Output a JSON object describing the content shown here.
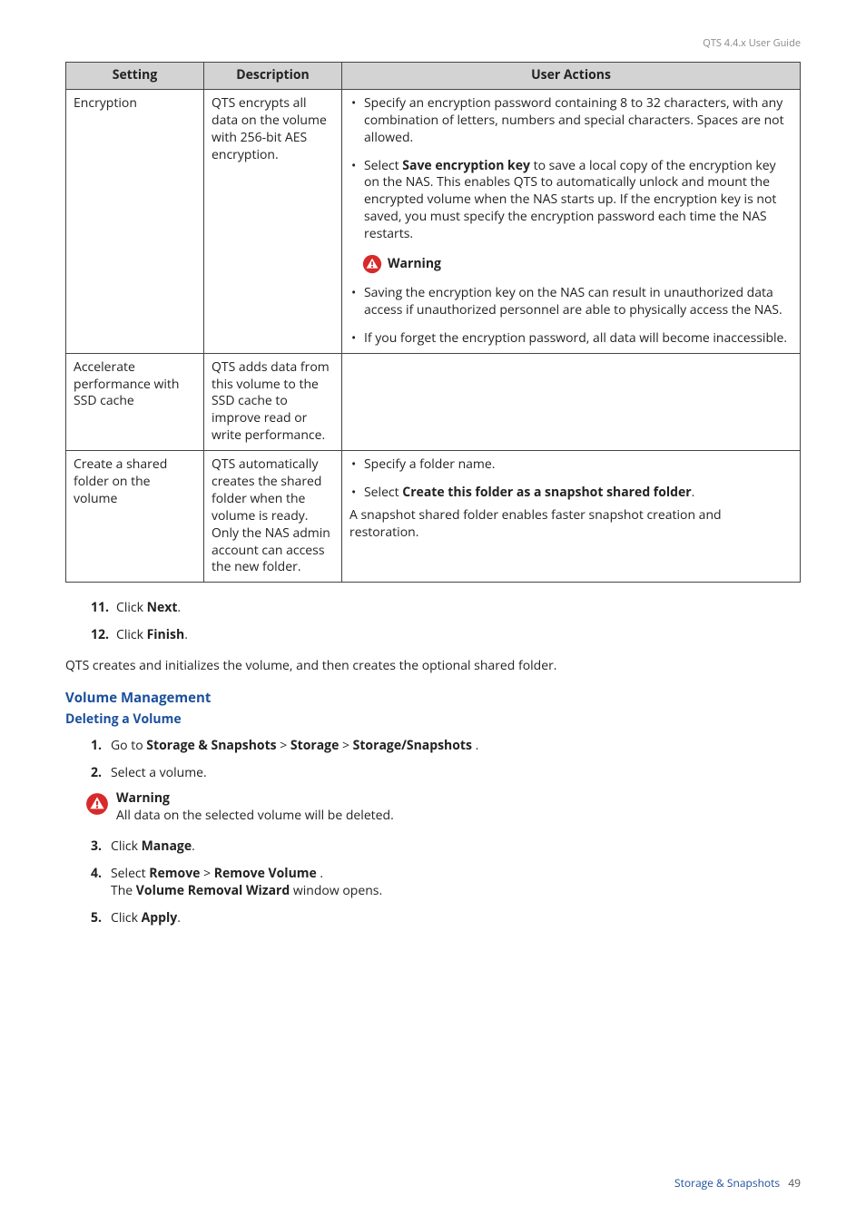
{
  "header": {
    "guide_title": "QTS 4.4.x User Guide"
  },
  "table": {
    "headers": {
      "setting": "Setting",
      "description": "Description",
      "user_actions": "User Actions"
    },
    "rows": [
      {
        "setting": "Encryption",
        "description": "QTS encrypts all data on the volume with 256-bit AES encryption.",
        "actions": {
          "a1": "Specify an encryption password containing 8 to 32 characters, with any combination of letters, numbers and special characters. Spaces are not allowed.",
          "a2_pre": "Select ",
          "a2_b": "Save encryption key",
          "a2_post": " to save a local copy of the encryption key on the NAS. This enables QTS to automatically unlock and mount the encrypted volume when the NAS starts up. If the encryption key is not saved, you must specify the encryption password each time the NAS restarts.",
          "warning_label": "Warning",
          "w1": "Saving the encryption key on the NAS can result in unauthorized data access if unauthorized personnel are able to physically access the NAS.",
          "w2": "If you forget the encryption password, all data will become inaccessible."
        }
      },
      {
        "setting": "Accelerate performance with SSD cache",
        "description": "QTS adds data from this volume to the SSD cache to improve read or write performance."
      },
      {
        "setting": "Create a shared folder on the volume",
        "description": "QTS automatically creates the shared folder when the volume is ready. Only the NAS admin account can access the new folder.",
        "actions": {
          "a1": "Specify a folder name.",
          "a2_pre": "Select ",
          "a2_b": "Create this folder as a snapshot shared folder",
          "a2_post": ".",
          "note": "A snapshot shared folder enables faster snapshot creation and restoration."
        }
      }
    ]
  },
  "steps_top": {
    "s11_pre": "Click ",
    "s11_b": "Next",
    "s11_post": ".",
    "s12_pre": "Click ",
    "s12_b": "Finish",
    "s12_post": "."
  },
  "para_after": "QTS creates and initializes the volume, and then creates the optional shared folder.",
  "section": {
    "title": "Volume Management",
    "subtitle": "Deleting a Volume"
  },
  "substeps": {
    "s1_pre": "Go to ",
    "s1_b1": "Storage & Snapshots",
    "s1_sep1": " > ",
    "s1_b2": "Storage",
    "s1_sep2": " > ",
    "s1_b3": "Storage/Snapshots",
    "s1_post": " .",
    "s2": "Select a volume.",
    "warning_title": "Warning",
    "warning_body": "All data on the selected volume will be deleted.",
    "s3_pre": "Click ",
    "s3_b": "Manage",
    "s3_post": ".",
    "s4a_pre": "Select ",
    "s4a_b1": "Remove",
    "s4a_sep": " > ",
    "s4a_b2": "Remove Volume",
    "s4a_post": " .",
    "s4b_pre": "The ",
    "s4b_b": "Volume Removal Wizard",
    "s4b_post": " window opens.",
    "s5_pre": "Click ",
    "s5_b": "Apply",
    "s5_post": "."
  },
  "footer": {
    "text": "Storage & Snapshots",
    "page": "49"
  }
}
